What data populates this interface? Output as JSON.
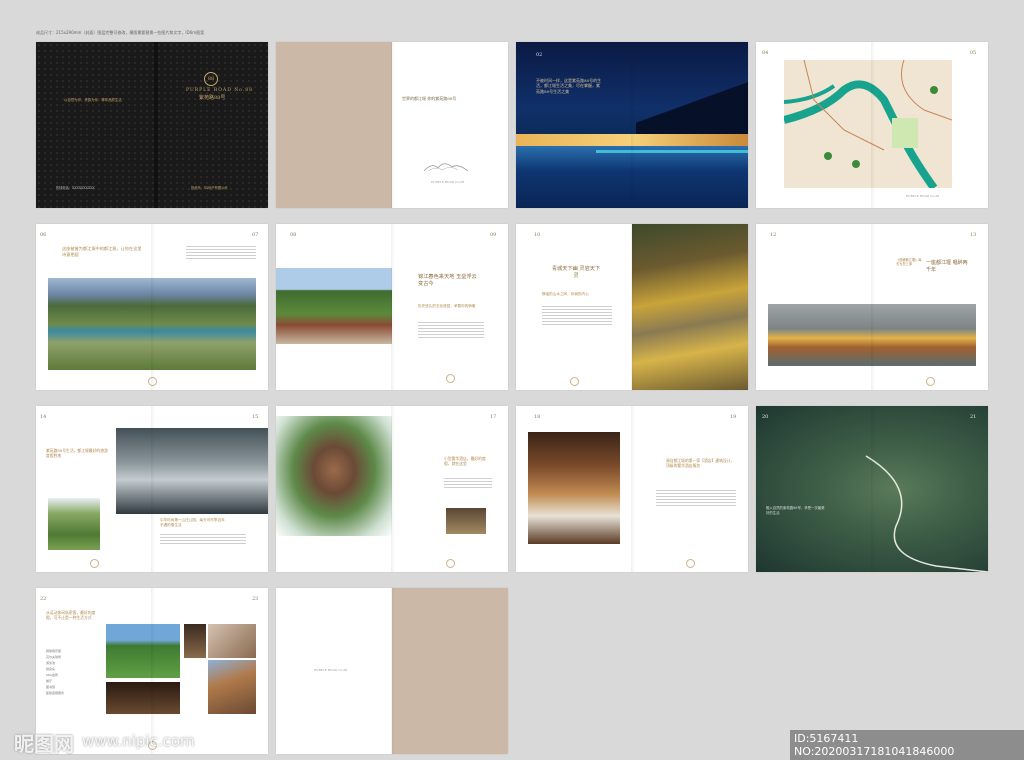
{
  "header": {
    "text": "成品尺寸：215x290mm（封面）图层完整可修改，模版需要替换一些图片和文字，ID6m图案"
  },
  "cover": {
    "brand_en": "PURPLE ROAD No.88",
    "brand_cn": "紫苑路88号",
    "monogram": "88",
    "tagline": "以自然为邻，贵族为伴，尊享品质生活",
    "hotline_label": "热线电话：",
    "hotline": "XXXXXXXXXX",
    "developer": "投资商：XX地产有限公司"
  },
  "spreads": {
    "s2": {
      "title": "世界的都江堰 你的紫苑路88号",
      "footer": "PURPLE ROAD No.88"
    },
    "s3": {
      "page": "02",
      "text": "不被时间一样，这是紫苑路88号的生活，都江堰生活之美，尽在掌握，紫苑路88号生活之美"
    },
    "s4": {
      "page_left": "04",
      "page_right": "05",
      "footer": "PURPLE ROAD No.88"
    },
    "s5": {
      "page_left": "06",
      "page_right": "07",
      "title": "这座被誉为都江堰中的都江堰，让你在这里诗意栖居"
    },
    "s6": {
      "page_left": "08",
      "page_right": "09",
      "title": "锦江春色来天地 玉垒浮云变古今",
      "sub": "历史悠久的文化底蕴，承载你的骄傲"
    },
    "s7": {
      "page": "10",
      "title": "青城天下幽 灵岩天下灵",
      "sub": "静谧的山水之间，你我的内心"
    },
    "s8": {
      "page_left": "12",
      "page_right": "13",
      "title": "一座都江堰 唱醉两千年",
      "sub": "《道解都江堰》每天为您上演"
    },
    "s9": {
      "page_left": "14",
      "page_right": "15",
      "title": "紫苑路88号生活，都江堰最好的旅游度假胜地",
      "sub": "中华时尚第一山庄公园，每天可尽享百年不遇的慢生活"
    },
    "s10": {
      "page": "17",
      "title": "小型奢华酒店，最好的度假，就在这里"
    },
    "s11": {
      "page_left": "18",
      "page_right": "19",
      "title": "源自都江堰的第一家【酒店】建筑设计，顶级的奢华酒店服务"
    },
    "s12": {
      "page_left": "20",
      "page_right": "21",
      "caption": "融入自然的紫苑路88号，享受一次最美好的生活"
    },
    "s13": {
      "page_left": "22",
      "page_right": "23",
      "title": "从运动休闲私密客，最好的度假，可不止是一种生活方式",
      "list": [
        "网球俱乐部",
        "高尔夫球场",
        "游泳池",
        "健身房",
        "SPA会所",
        "餐厅",
        "图书馆",
        "星级度假服务"
      ]
    },
    "s14": {
      "footer": "PURPLE ROAD No.88"
    }
  },
  "watermark": {
    "logo": "昵图网",
    "url": "www.nipic.com",
    "id": "ID:5167411 NO:20200317181041846000"
  },
  "colors": {
    "tan": "#cbb8a6",
    "night": "#0d1f45",
    "gold": "#b0894d"
  }
}
